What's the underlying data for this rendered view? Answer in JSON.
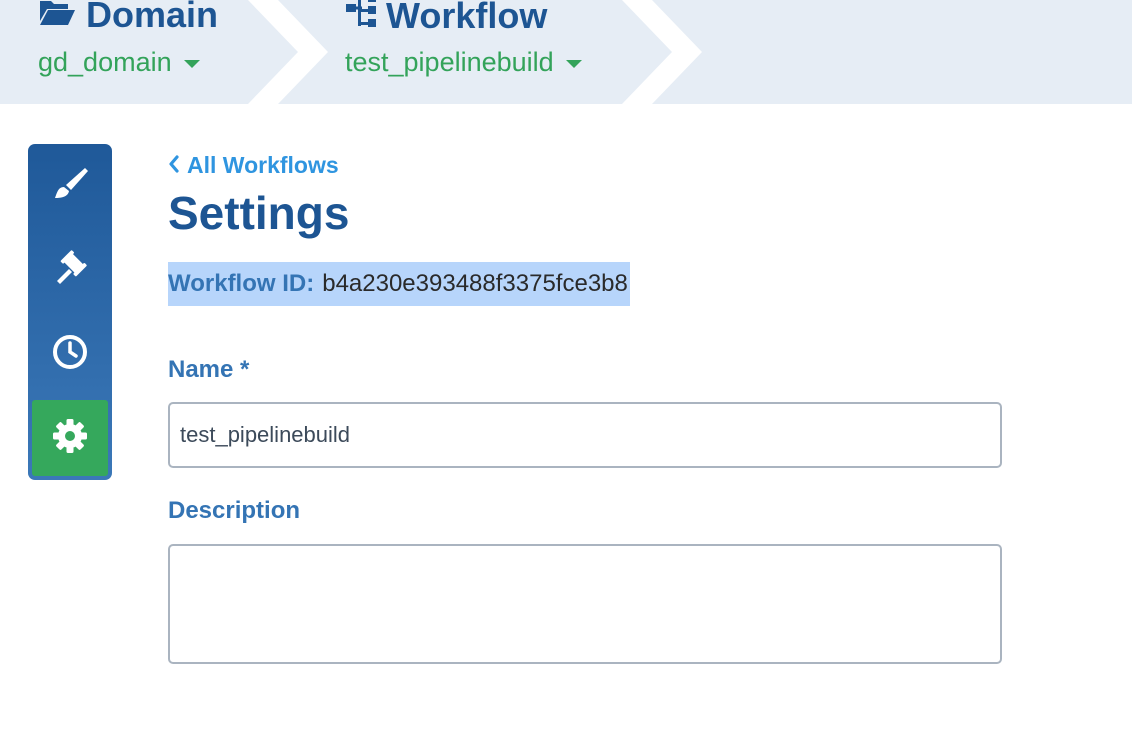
{
  "breadcrumb": {
    "domain": {
      "title": "Domain",
      "value": "gd_domain",
      "icon": "folder-open-icon"
    },
    "workflow": {
      "title": "Workflow",
      "value": "test_pipelinebuild",
      "icon": "sitemap-icon"
    }
  },
  "sidenav": {
    "items": [
      {
        "name": "paintbrush-icon",
        "active": false
      },
      {
        "name": "gavel-icon",
        "active": false
      },
      {
        "name": "clock-icon",
        "active": false
      },
      {
        "name": "gear-icon",
        "active": true
      }
    ]
  },
  "main": {
    "back_link": "All Workflows",
    "title": "Settings",
    "workflow_id_label": "Workflow ID:",
    "workflow_id_value": "b4a230e393488f3375fce3b8",
    "name_label": "Name *",
    "name_value": "test_pipelinebuild",
    "description_label": "Description",
    "description_value": ""
  },
  "colors": {
    "brand_blue": "#1d5593",
    "link_blue": "#2f95e0",
    "accent_green": "#35a85c",
    "crumb_bg": "#e6edf5",
    "selection": "#b7d5fb"
  }
}
